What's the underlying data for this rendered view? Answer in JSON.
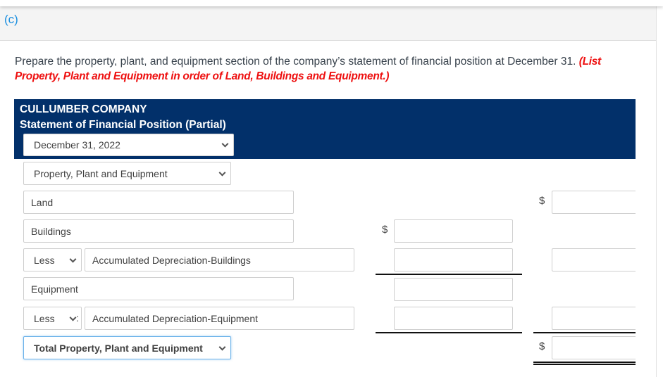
{
  "part": {
    "label": "(c)"
  },
  "instructions": {
    "text": "Prepare the property, plant, and equipment section of the company’s statement of financial position at December 31. ",
    "emphasis": "(List Property, Plant and Equipment in order of Land, Buildings and Equipment.)"
  },
  "header": {
    "company": "CULLUMBER COMPANY",
    "statement": "Statement of Financial Position (Partial)",
    "date_select": "December 31, 2022"
  },
  "section_select": "Property, Plant and Equipment",
  "rows": {
    "land": {
      "label": "Land",
      "col2_value": "",
      "currency": "$"
    },
    "buildings": {
      "label": "Buildings",
      "col1_value": "",
      "currency": "$"
    },
    "acc_dep_buildings": {
      "operator": "Less",
      "separator": ":",
      "label": "Accumulated Depreciation-Buildings",
      "col1_value": "",
      "col2_value": ""
    },
    "equipment": {
      "label": "Equipment",
      "col1_value": ""
    },
    "acc_dep_equipment": {
      "operator": "Less",
      "separator": ":",
      "label": "Accumulated Depreciation-Equipment",
      "col1_value": "",
      "col2_value": ""
    },
    "total": {
      "label": "Total Property, Plant and Equipment",
      "col2_value": "",
      "currency": "$"
    }
  },
  "colors": {
    "navy": "#02306a",
    "part_label": "#1a8fe0",
    "emphasis_red": "#ee1111"
  }
}
